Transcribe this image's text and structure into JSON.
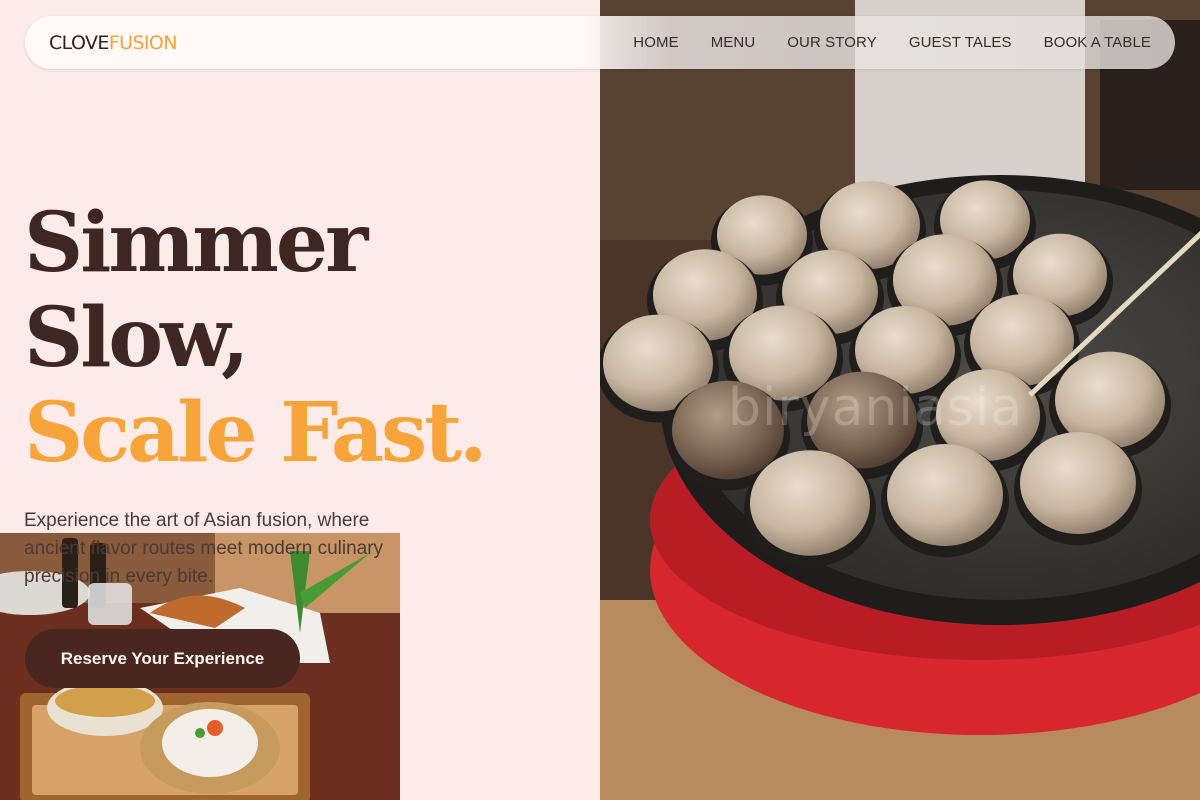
{
  "brand": {
    "part1": "CLOVE",
    "part2": "FUSION"
  },
  "nav": {
    "items": [
      "HOME",
      "MENU",
      "OUR STORY",
      "GUEST TALES",
      "BOOK A TABLE"
    ]
  },
  "hero": {
    "title_line1": "Simmer",
    "title_line2": "Slow,",
    "title_line3": "Scale Fast.",
    "description": "Experience the art of Asian fusion, where ancient flavor routes meet modern culinary precision in every bite.",
    "cta_label": "Reserve Your Experience"
  },
  "images": {
    "right": "takoyaki-pan-photo",
    "left": "asian-dinner-table-photo",
    "watermark": "biryaniasia"
  },
  "colors": {
    "background": "#fdebea",
    "text_dark": "#3e2723",
    "accent": "#f7a43b",
    "button": "#4a2620",
    "pan_red": "#d7262e"
  }
}
